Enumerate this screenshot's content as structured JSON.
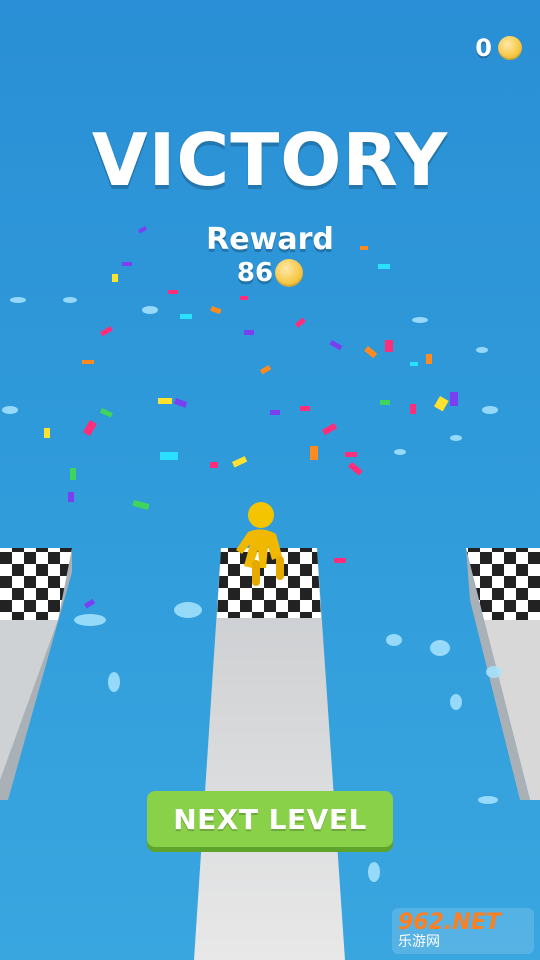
{
  "hud": {
    "coin_count": "0"
  },
  "title": "VICTORY",
  "reward": {
    "label": "Reward",
    "amount": "86"
  },
  "next_button": {
    "label": "NEXT LEVEL"
  },
  "watermark": {
    "brand": "962.NET",
    "site": "乐游网"
  },
  "colors": {
    "sky": "#2f9ad9",
    "button_green": "#8ad14a",
    "runner_yellow": "#f5c400",
    "track_gray": "#d9d9d9"
  },
  "icons": [
    "coin-icon",
    "stickman-runner",
    "checkered-finish-line",
    "confetti"
  ]
}
